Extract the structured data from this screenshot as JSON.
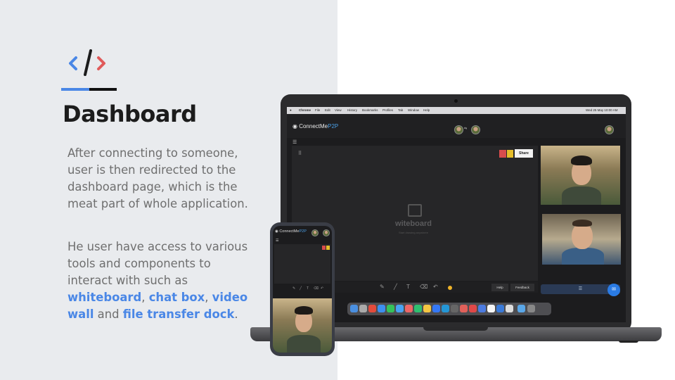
{
  "slide": {
    "title": "Dashboard",
    "paragraph1": "After connecting to someone, user is then redirected to the dashboard page, which is the meat part of whole application.",
    "paragraph2": {
      "intro": "He user have access to various tools and components to interact with such as ",
      "items": [
        "whiteboard",
        "chat box",
        "video wall",
        "file transfer dock"
      ],
      "sep1": ", ",
      "sep2": ", ",
      "sep3": " and ",
      "end": "."
    },
    "colors": {
      "accent": "#4a87e6",
      "panel_bg": "#e9ebee",
      "text": "#6f6f6f",
      "code_icon_left": "#4a87e6",
      "code_icon_right": "#e05a5a"
    },
    "icon": "code-brackets-icon"
  },
  "app": {
    "brand_prefix": "ConnectMe",
    "brand_suffix": "P2P",
    "menubar": [
      "Chrome",
      "File",
      "Edit",
      "View",
      "History",
      "Bookmarks",
      "Profiles",
      "Tab",
      "Window",
      "Help"
    ],
    "clock": "Wed 25 May  10:00 AM",
    "share_label": "Share",
    "whiteboard_logo": "witeboard",
    "whiteboard_sub": "Start drawing anywhere",
    "help_label": "Help",
    "feedback_label": "Feedback",
    "chat_bar_icon": "menu-icon"
  }
}
